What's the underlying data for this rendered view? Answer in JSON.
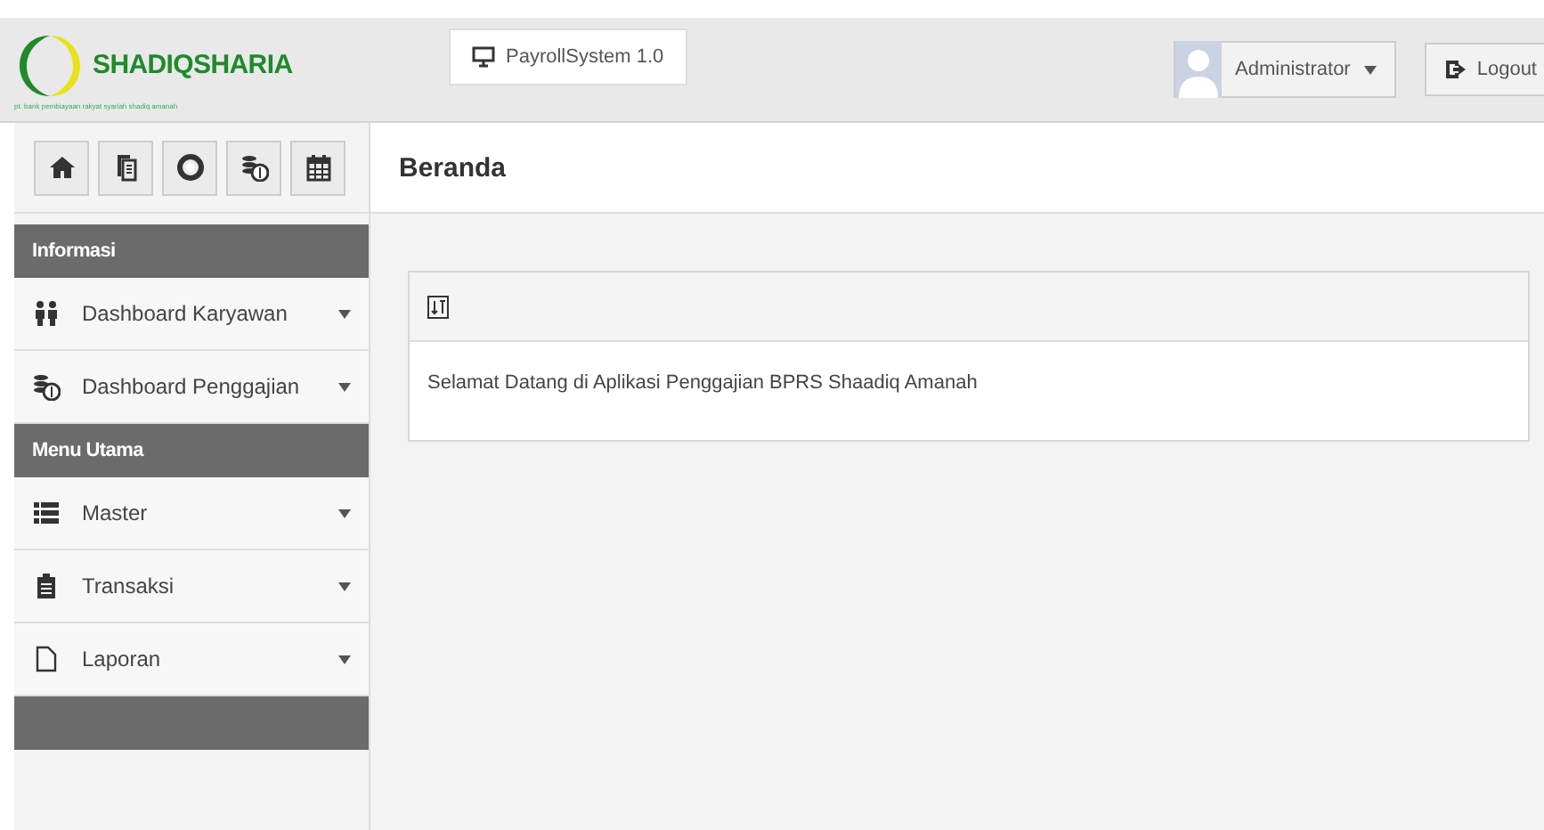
{
  "header": {
    "logo": {
      "name": "SHADIQSHARIA",
      "tagline": "pt. bank pembiayaan rakyat syariah shadiq amanah"
    },
    "app_badge": "PayrollSystem 1.0",
    "user": "Administrator",
    "logout": "Logout"
  },
  "toolbar": [
    {
      "kind": "home"
    },
    {
      "kind": "copy"
    },
    {
      "kind": "lifebuoy"
    },
    {
      "kind": "coins"
    },
    {
      "kind": "calendar"
    }
  ],
  "page_title": "Beranda",
  "sidebar": [
    {
      "kind": "section",
      "label": "Informasi"
    },
    {
      "kind": "people",
      "label": "Dashboard Karyawan"
    },
    {
      "kind": "coins",
      "label": "Dashboard Penggajian"
    },
    {
      "kind": "section",
      "label": "Menu Utama"
    },
    {
      "kind": "list",
      "label": "Master"
    },
    {
      "kind": "clipboard",
      "label": "Transaksi"
    },
    {
      "kind": "file",
      "label": "Laporan"
    },
    {
      "kind": "section"
    }
  ],
  "panel": {
    "message": "Selamat Datang di Aplikasi Penggajian BPRS Shaadiq Amanah"
  }
}
